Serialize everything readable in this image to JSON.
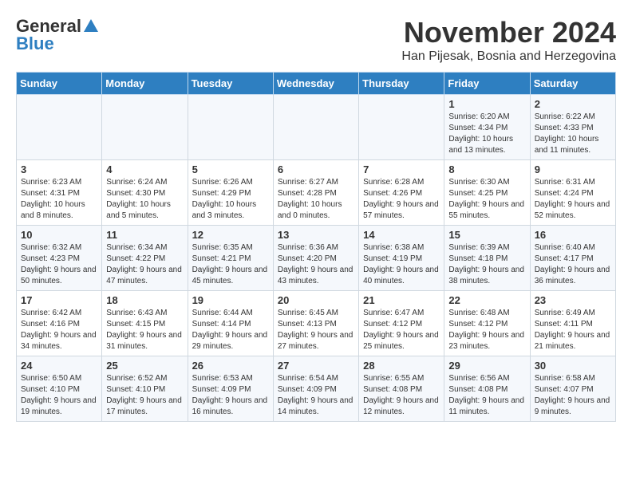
{
  "header": {
    "logo_general": "General",
    "logo_blue": "Blue",
    "month_title": "November 2024",
    "subtitle": "Han Pijesak, Bosnia and Herzegovina"
  },
  "days_of_week": [
    "Sunday",
    "Monday",
    "Tuesday",
    "Wednesday",
    "Thursday",
    "Friday",
    "Saturday"
  ],
  "weeks": [
    [
      {
        "day": "",
        "info": ""
      },
      {
        "day": "",
        "info": ""
      },
      {
        "day": "",
        "info": ""
      },
      {
        "day": "",
        "info": ""
      },
      {
        "day": "",
        "info": ""
      },
      {
        "day": "1",
        "info": "Sunrise: 6:20 AM\nSunset: 4:34 PM\nDaylight: 10 hours and 13 minutes."
      },
      {
        "day": "2",
        "info": "Sunrise: 6:22 AM\nSunset: 4:33 PM\nDaylight: 10 hours and 11 minutes."
      }
    ],
    [
      {
        "day": "3",
        "info": "Sunrise: 6:23 AM\nSunset: 4:31 PM\nDaylight: 10 hours and 8 minutes."
      },
      {
        "day": "4",
        "info": "Sunrise: 6:24 AM\nSunset: 4:30 PM\nDaylight: 10 hours and 5 minutes."
      },
      {
        "day": "5",
        "info": "Sunrise: 6:26 AM\nSunset: 4:29 PM\nDaylight: 10 hours and 3 minutes."
      },
      {
        "day": "6",
        "info": "Sunrise: 6:27 AM\nSunset: 4:28 PM\nDaylight: 10 hours and 0 minutes."
      },
      {
        "day": "7",
        "info": "Sunrise: 6:28 AM\nSunset: 4:26 PM\nDaylight: 9 hours and 57 minutes."
      },
      {
        "day": "8",
        "info": "Sunrise: 6:30 AM\nSunset: 4:25 PM\nDaylight: 9 hours and 55 minutes."
      },
      {
        "day": "9",
        "info": "Sunrise: 6:31 AM\nSunset: 4:24 PM\nDaylight: 9 hours and 52 minutes."
      }
    ],
    [
      {
        "day": "10",
        "info": "Sunrise: 6:32 AM\nSunset: 4:23 PM\nDaylight: 9 hours and 50 minutes."
      },
      {
        "day": "11",
        "info": "Sunrise: 6:34 AM\nSunset: 4:22 PM\nDaylight: 9 hours and 47 minutes."
      },
      {
        "day": "12",
        "info": "Sunrise: 6:35 AM\nSunset: 4:21 PM\nDaylight: 9 hours and 45 minutes."
      },
      {
        "day": "13",
        "info": "Sunrise: 6:36 AM\nSunset: 4:20 PM\nDaylight: 9 hours and 43 minutes."
      },
      {
        "day": "14",
        "info": "Sunrise: 6:38 AM\nSunset: 4:19 PM\nDaylight: 9 hours and 40 minutes."
      },
      {
        "day": "15",
        "info": "Sunrise: 6:39 AM\nSunset: 4:18 PM\nDaylight: 9 hours and 38 minutes."
      },
      {
        "day": "16",
        "info": "Sunrise: 6:40 AM\nSunset: 4:17 PM\nDaylight: 9 hours and 36 minutes."
      }
    ],
    [
      {
        "day": "17",
        "info": "Sunrise: 6:42 AM\nSunset: 4:16 PM\nDaylight: 9 hours and 34 minutes."
      },
      {
        "day": "18",
        "info": "Sunrise: 6:43 AM\nSunset: 4:15 PM\nDaylight: 9 hours and 31 minutes."
      },
      {
        "day": "19",
        "info": "Sunrise: 6:44 AM\nSunset: 4:14 PM\nDaylight: 9 hours and 29 minutes."
      },
      {
        "day": "20",
        "info": "Sunrise: 6:45 AM\nSunset: 4:13 PM\nDaylight: 9 hours and 27 minutes."
      },
      {
        "day": "21",
        "info": "Sunrise: 6:47 AM\nSunset: 4:12 PM\nDaylight: 9 hours and 25 minutes."
      },
      {
        "day": "22",
        "info": "Sunrise: 6:48 AM\nSunset: 4:12 PM\nDaylight: 9 hours and 23 minutes."
      },
      {
        "day": "23",
        "info": "Sunrise: 6:49 AM\nSunset: 4:11 PM\nDaylight: 9 hours and 21 minutes."
      }
    ],
    [
      {
        "day": "24",
        "info": "Sunrise: 6:50 AM\nSunset: 4:10 PM\nDaylight: 9 hours and 19 minutes."
      },
      {
        "day": "25",
        "info": "Sunrise: 6:52 AM\nSunset: 4:10 PM\nDaylight: 9 hours and 17 minutes."
      },
      {
        "day": "26",
        "info": "Sunrise: 6:53 AM\nSunset: 4:09 PM\nDaylight: 9 hours and 16 minutes."
      },
      {
        "day": "27",
        "info": "Sunrise: 6:54 AM\nSunset: 4:09 PM\nDaylight: 9 hours and 14 minutes."
      },
      {
        "day": "28",
        "info": "Sunrise: 6:55 AM\nSunset: 4:08 PM\nDaylight: 9 hours and 12 minutes."
      },
      {
        "day": "29",
        "info": "Sunrise: 6:56 AM\nSunset: 4:08 PM\nDaylight: 9 hours and 11 minutes."
      },
      {
        "day": "30",
        "info": "Sunrise: 6:58 AM\nSunset: 4:07 PM\nDaylight: 9 hours and 9 minutes."
      }
    ]
  ]
}
